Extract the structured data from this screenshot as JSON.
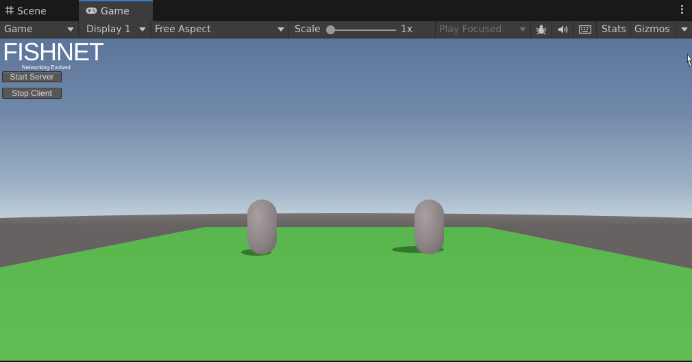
{
  "tabs": [
    {
      "label": "Scene",
      "icon": "grid-icon"
    },
    {
      "label": "Game",
      "icon": "gamepad-icon",
      "active": true
    }
  ],
  "toolbar": {
    "display_mode": "Game",
    "display": "Display 1",
    "aspect": "Free Aspect",
    "scale_label": "Scale",
    "scale_value": "1x",
    "play_mode": "Play Focused",
    "stats": "Stats",
    "gizmos": "Gizmos"
  },
  "game": {
    "logo_main": "FISHNET",
    "logo_sub": "Networking Evolved",
    "start_server": "Start Server",
    "stop_client": "Stop Client"
  },
  "colors": {
    "ground": "#5ab94f",
    "wall": "#6b6767",
    "capsule": "#8f8787",
    "active_tab_accent": "#3a79bb"
  }
}
